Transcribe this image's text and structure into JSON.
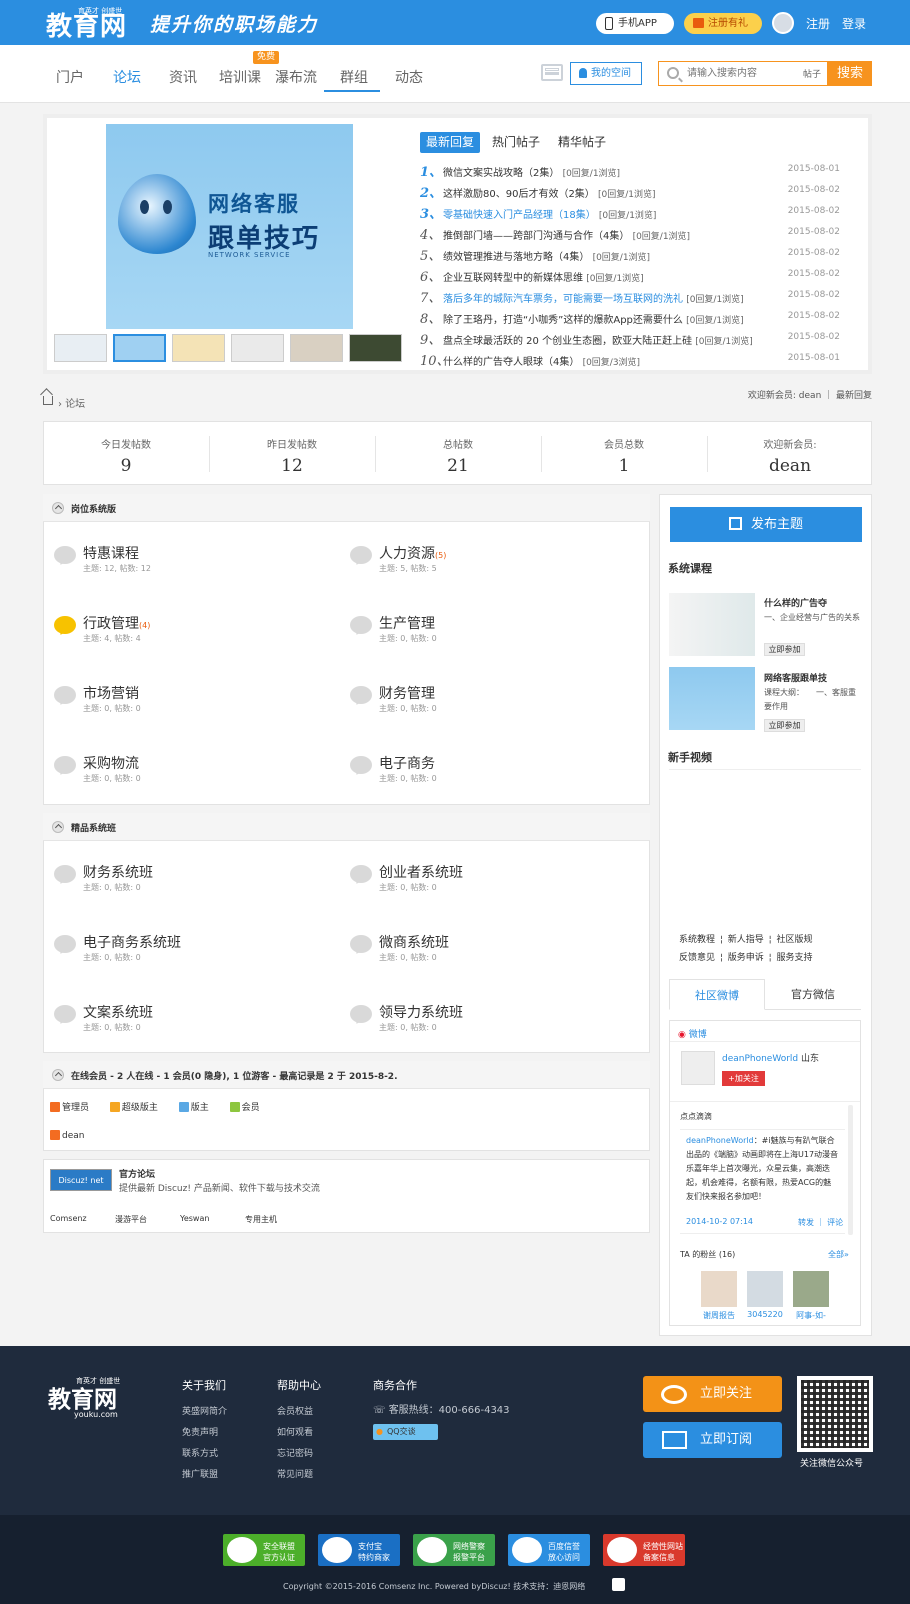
{
  "header": {
    "logo": "教育网",
    "logo_small": "育英才 创盛世",
    "slogan": "提升你的职场能力",
    "app_label": "手机APP",
    "register_gift_label": "注册有礼",
    "register_label": "注册",
    "login_label": "登录"
  },
  "nav": {
    "items": [
      "门户",
      "论坛",
      "资讯",
      "培训课",
      "瀑布流",
      "群组",
      "动态"
    ],
    "active": "论坛",
    "free_badge": "免费",
    "my_space_label": "我的空间",
    "search_placeholder": "请输入搜索内容",
    "search_scope": "帖子",
    "search_button": "搜索"
  },
  "slider": {
    "slide_title_1": "网络客服",
    "slide_title_2": "跟单技巧",
    "slide_subtitle": "NETWORK SERVICE"
  },
  "hot": {
    "tabs": [
      "最新回复",
      "热门帖子",
      "精华帖子"
    ],
    "items": [
      {
        "n": "1、",
        "title": "微信文案实战攻略（2集）",
        "count": "[0回复/1浏览]",
        "date": "2015-08-01",
        "link": false
      },
      {
        "n": "2、",
        "title": "这样激励80、90后才有效（2集）",
        "count": "[0回复/1浏览]",
        "date": "2015-08-02",
        "link": false
      },
      {
        "n": "3、",
        "title": "零基础快速入门产品经理（18集）",
        "count": "[0回复/1浏览]",
        "date": "2015-08-02",
        "link": true
      },
      {
        "n": "4、",
        "title": "推倒部门墙——跨部门沟通与合作（4集）",
        "count": "[0回复/1浏览]",
        "date": "2015-08-02",
        "link": false
      },
      {
        "n": "5、",
        "title": "绩效管理推进与落地方略（4集）",
        "count": "[0回复/1浏览]",
        "date": "2015-08-02",
        "link": false
      },
      {
        "n": "6、",
        "title": "企业互联网转型中的新媒体思维",
        "count": "[0回复/1浏览]",
        "date": "2015-08-02",
        "link": false
      },
      {
        "n": "7、",
        "title": "落后多年的城际汽车票务，可能需要一场互联网的洗礼",
        "count": "[0回复/1浏览]",
        "date": "2015-08-02",
        "link": true
      },
      {
        "n": "8、",
        "title": "除了王珞丹，打造“小咖秀”这样的爆款App还需要什么",
        "count": "[0回复/1浏览]",
        "date": "2015-08-02",
        "link": false
      },
      {
        "n": "9、",
        "title": "盘点全球最活跃的 20 个创业生态圈，欧亚大陆正赶上硅",
        "count": "[0回复/1浏览]",
        "date": "2015-08-02",
        "link": false
      },
      {
        "n": "10、",
        "title": "什么样的广告夺人眼球（4集）",
        "count": "[0回复/3浏览]",
        "date": "2015-08-01",
        "link": false
      }
    ]
  },
  "breadcrumb": {
    "current": "论坛",
    "right": "欢迎新会员: dean ｜ 最新回复"
  },
  "stats": [
    {
      "label": "今日发帖数",
      "value": "9"
    },
    {
      "label": "昨日发帖数",
      "value": "12"
    },
    {
      "label": "总帖数",
      "value": "21"
    },
    {
      "label": "会员总数",
      "value": "1"
    },
    {
      "label": "欢迎新会员:",
      "value": "dean"
    }
  ],
  "section1": {
    "title": "岗位系统版",
    "forums": [
      {
        "name": "特惠课程",
        "count": "",
        "stats": "主题: 12, 帖数: 12",
        "new": false
      },
      {
        "name": "人力资源",
        "count": "(5)",
        "stats": "主题: 5, 帖数: 5",
        "new": false
      },
      {
        "name": "行政管理",
        "count": "(4)",
        "stats": "主题: 4, 帖数: 4",
        "new": true
      },
      {
        "name": "生产管理",
        "count": "",
        "stats": "主题: 0, 帖数: 0",
        "new": false
      },
      {
        "name": "市场营销",
        "count": "",
        "stats": "主题: 0, 帖数: 0",
        "new": false
      },
      {
        "name": "财务管理",
        "count": "",
        "stats": "主题: 0, 帖数: 0",
        "new": false
      },
      {
        "name": "采购物流",
        "count": "",
        "stats": "主题: 0, 帖数: 0",
        "new": false
      },
      {
        "name": "电子商务",
        "count": "",
        "stats": "主题: 0, 帖数: 0",
        "new": false
      }
    ]
  },
  "section2": {
    "title": "精品系统班",
    "forums": [
      {
        "name": "财务系统班",
        "stats": "主题: 0, 帖数: 0"
      },
      {
        "name": "创业者系统班",
        "stats": "主题: 0, 帖数: 0"
      },
      {
        "name": "电子商务系统班",
        "stats": "主题: 0, 帖数: 0"
      },
      {
        "name": "微商系统班",
        "stats": "主题: 0, 帖数: 0"
      },
      {
        "name": "文案系统班",
        "stats": "主题: 0, 帖数: 0"
      },
      {
        "name": "领导力系统班",
        "stats": "主题: 0, 帖数: 0"
      }
    ]
  },
  "online": {
    "title": "在线会员 - 2 人在线 - 1 会员(0 隐身), 1 位游客 - 最高记录是 2 于 2015-8-2.",
    "legend": [
      "管理员",
      "超级版主",
      "版主",
      "会员"
    ],
    "member": "dean"
  },
  "links": {
    "logo_text": "Discuz! net",
    "title": "官方论坛",
    "desc": "提供最新 Discuz! 产品新闻、软件下载与技术交流",
    "friends": [
      "Comsenz",
      "漫游平台",
      "Yeswan",
      "专用主机"
    ]
  },
  "sidebar": {
    "post_button": "发布主题",
    "course_heading": "系统课程",
    "courses": [
      {
        "title": "什么样的广告夺",
        "desc": "一、企业经营与广告的关系",
        "join": "立即参加"
      },
      {
        "title": "网络客服跟单技",
        "desc": "课程大纲：　　一、客服重要作用",
        "join": "立即参加"
      }
    ],
    "video_heading": "新手视频",
    "links_row1": "系统教程 ¦ 新人指导 ¦ 社区版规",
    "links_row2": "反馈意见 ¦ 版务申诉 ¦ 服务支持",
    "weibo_tabs": [
      "社区微博",
      "官方微信"
    ],
    "weibo": {
      "label": "微博",
      "user": "deanPhoneWorld",
      "location": "山东",
      "follow": "+加关注",
      "square": "点点滴滴",
      "post_user": "deanPhoneWorld",
      "post_text": "：#i魅族与有趴气联合出品的《端脑》动画即将在上海U17动漫音乐嘉年华上首次曝光，众星云集，高潮迭起，机会难得，名额有限，热爱ACG的魅友们快来报名参加吧！",
      "post_date": "2014-10-2 07:14",
      "post_actions": "转发 ｜ 评论",
      "fans_title": "TA 的粉丝 (16)",
      "fans_all": "全部»",
      "fans": [
        "谢周报告",
        "3045220",
        "阿事-如-"
      ]
    }
  },
  "footer": {
    "logo": "教育网",
    "logo_small": "育英才 创盛世",
    "logo_domain": "youku.com",
    "col1_title": "关于我们",
    "col1": [
      "英盛网简介",
      "免责声明",
      "联系方式",
      "推广联盟"
    ],
    "col2_title": "帮助中心",
    "col2": [
      "会员权益",
      "如何观看",
      "忘记密码",
      "常见问题"
    ],
    "col3_title": "商务合作",
    "hotline": "客服热线：400-666-4343",
    "qq_label": "QQ交谈",
    "follow_button": "立即关注",
    "subscribe_button": "立即订阅",
    "qr_caption": "关注微信公众号",
    "badges": [
      {
        "l1": "安全联盟",
        "l2": "官方认证",
        "color": "#4caf2a"
      },
      {
        "l1": "支付宝",
        "l2": "特约商家",
        "color": "#1a6fc4"
      },
      {
        "l1": "网络警察",
        "l2": "报警平台",
        "color": "#3aa14a"
      },
      {
        "l1": "百度信誉",
        "l2": "放心访问",
        "color": "#2b8ee0"
      },
      {
        "l1": "经营性网站",
        "l2": "备案信息",
        "color": "#d9392c"
      }
    ],
    "copyright": "Copyright  ©2015-2016  Comsenz Inc.  Powered byDiscuz!  技术支持：迪恩网络"
  },
  "colors": {
    "primary": "#2b8ee0",
    "accent": "#f7931e",
    "footer": "#1f2b3d"
  }
}
